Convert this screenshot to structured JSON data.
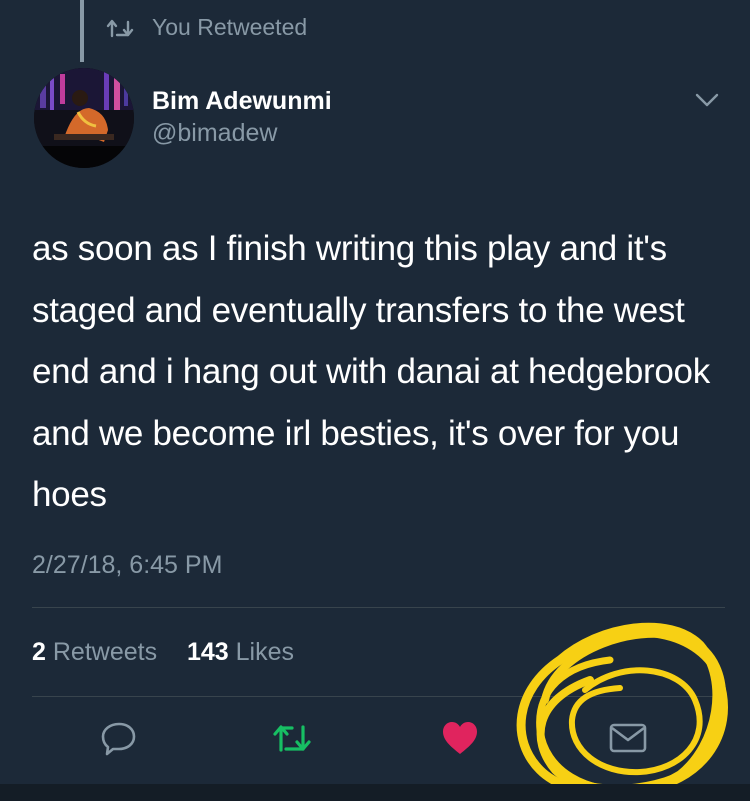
{
  "retweet_header": {
    "label": "You Retweeted"
  },
  "author": {
    "name": "Bim Adewunmi",
    "handle": "@bimadew"
  },
  "tweet": {
    "text": "as soon as I finish writing this play and it's staged and eventually transfers to the west end and i hang out with danai at hedgebrook and we become irl besties, it's over for you hoes",
    "timestamp": "2/27/18, 6:45 PM"
  },
  "stats": {
    "retweets_count": "2",
    "retweets_label": "Retweets",
    "likes_count": "143",
    "likes_label": "Likes"
  },
  "actions": [
    {
      "name": "reply",
      "icon": "speech-bubble-icon"
    },
    {
      "name": "retweet",
      "icon": "retweet-icon",
      "active": true
    },
    {
      "name": "like",
      "icon": "heart-icon",
      "active": true
    },
    {
      "name": "direct-message",
      "icon": "envelope-icon"
    }
  ],
  "colors": {
    "background": "#1c2938",
    "secondary_text": "#8899a6",
    "retweet_active": "#17bf63",
    "like_active": "#e0245e",
    "annotation_circle": "#f7d014"
  }
}
